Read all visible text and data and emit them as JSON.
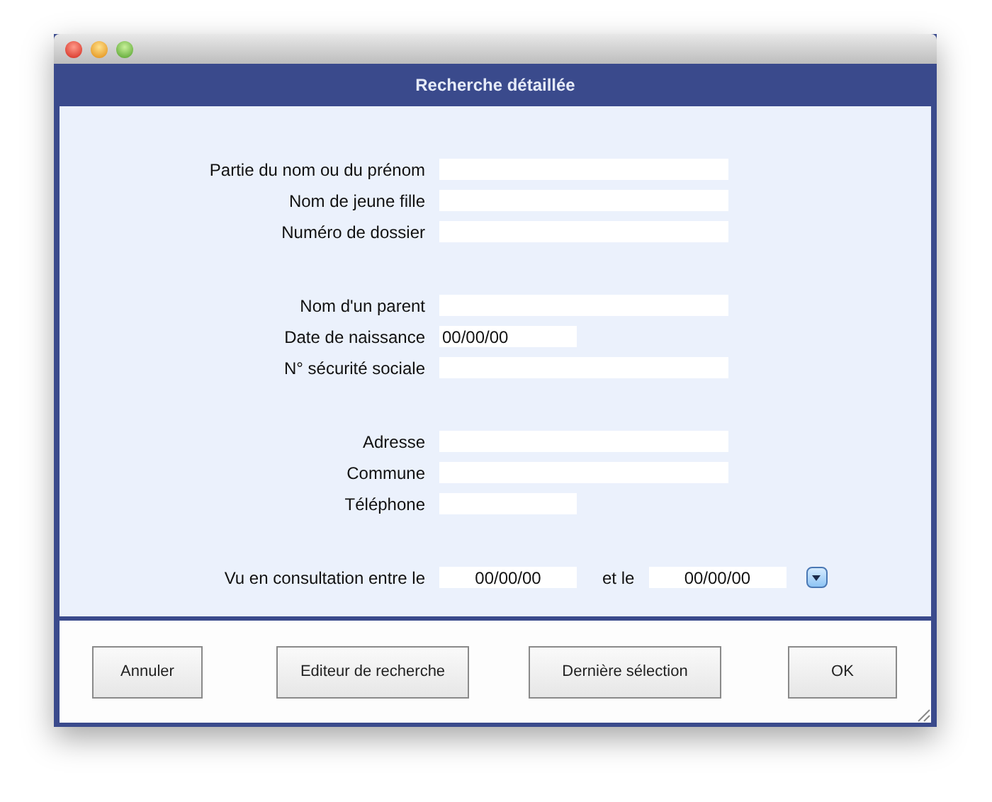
{
  "window": {
    "title": "Recherche détaillée"
  },
  "groups": [
    {
      "fields": [
        {
          "label": "Partie du nom ou du prénom",
          "kind": "wide"
        },
        {
          "label": "Nom de jeune fille",
          "kind": "wide"
        },
        {
          "label": "Numéro de dossier",
          "kind": "wide"
        }
      ]
    },
    {
      "fields": [
        {
          "label": "Nom d'un parent",
          "kind": "wide"
        },
        {
          "label": "Date de naissance",
          "kind": "short",
          "value": "00/00/00"
        },
        {
          "label": "N° sécurité sociale",
          "kind": "wide"
        }
      ]
    },
    {
      "fields": [
        {
          "label": "Adresse",
          "kind": "wide"
        },
        {
          "label": "Commune",
          "kind": "wide"
        },
        {
          "label": "Téléphone",
          "kind": "short"
        }
      ]
    }
  ],
  "consultation": {
    "label": "Vu en consultation entre le",
    "from": "00/00/00",
    "and_label": "et le",
    "to": "00/00/00"
  },
  "buttons": [
    "Annuler",
    "Editeur de recherche",
    "Dernière sélection",
    "OK"
  ]
}
